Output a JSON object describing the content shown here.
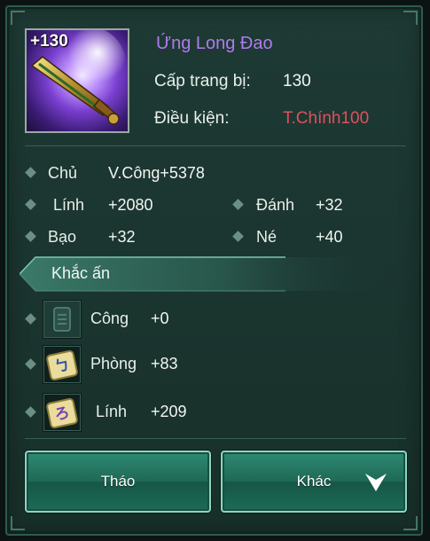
{
  "item": {
    "level_badge": "+130",
    "name": "Ứng Long Đao",
    "name_color": "#b07af0",
    "level_label": "Cấp trang bị:",
    "level_value": "130",
    "requirement_label": "Điều kiện:",
    "requirement_value": "T.Chính100",
    "requirement_color": "#e0505f",
    "icon": "golden-sword-icon"
  },
  "stats": {
    "main": {
      "label": "Chủ",
      "value": "V.Công+5378"
    },
    "grid": [
      {
        "label": "Lính",
        "value": "+2080"
      },
      {
        "label": "Đánh",
        "value": "+32"
      },
      {
        "label": "Bạo",
        "value": "+32"
      },
      {
        "label": "Né",
        "value": "+40"
      }
    ]
  },
  "engrave": {
    "title": "Khắc ấn",
    "slots": [
      {
        "label": "Công",
        "value": "+0",
        "icon": "empty-seal-slot-icon"
      },
      {
        "label": "Phòng",
        "value": "+83",
        "icon": "blue-rune-tile-icon"
      },
      {
        "label": "Lính",
        "value": "+209",
        "icon": "purple-rune-tile-icon"
      }
    ]
  },
  "actions": {
    "remove_label": "Tháo",
    "other_label": "Khác",
    "other_icon": "chevron-down-icon"
  }
}
